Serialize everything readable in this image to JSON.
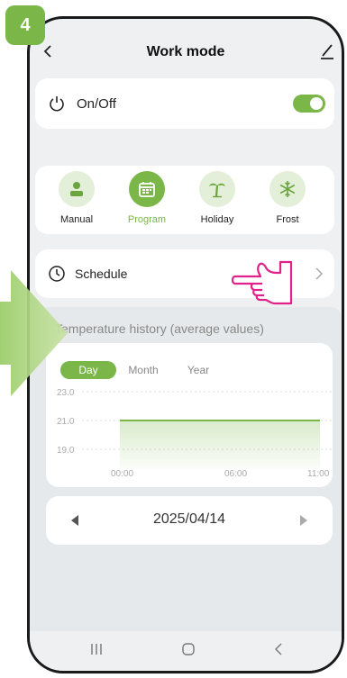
{
  "step_number": "4",
  "header": {
    "title": "Work mode"
  },
  "onoff": {
    "label": "On/Off",
    "state": "on"
  },
  "modes": [
    {
      "label": "Manual",
      "icon": "person-icon",
      "active": false
    },
    {
      "label": "Program",
      "icon": "calendar-icon",
      "active": true
    },
    {
      "label": "Holiday",
      "icon": "palm-tree-icon",
      "active": false
    },
    {
      "label": "Frost",
      "icon": "snowflake-icon",
      "active": false
    }
  ],
  "schedule": {
    "label": "Schedule"
  },
  "history": {
    "title": "Temperature history (average values)",
    "tabs": [
      "Day",
      "Month",
      "Year"
    ],
    "active_tab": "Day"
  },
  "chart_data": {
    "type": "area",
    "x": [
      "00:00",
      "11:00"
    ],
    "series": [
      {
        "values": [
          21.0,
          21.0
        ]
      }
    ],
    "y_ticks": [
      "23.0",
      "21.0",
      "19.0"
    ],
    "x_ticks": [
      "00:00",
      "06:00",
      "11:00"
    ],
    "ylim": [
      19.0,
      23.0
    ],
    "grid": true,
    "color": "#7ab648"
  },
  "date": {
    "label": "2025/04/14"
  },
  "colors": {
    "accent": "#7ab648",
    "accent_light": "#e3efd8",
    "pointer": "#e0218a"
  }
}
